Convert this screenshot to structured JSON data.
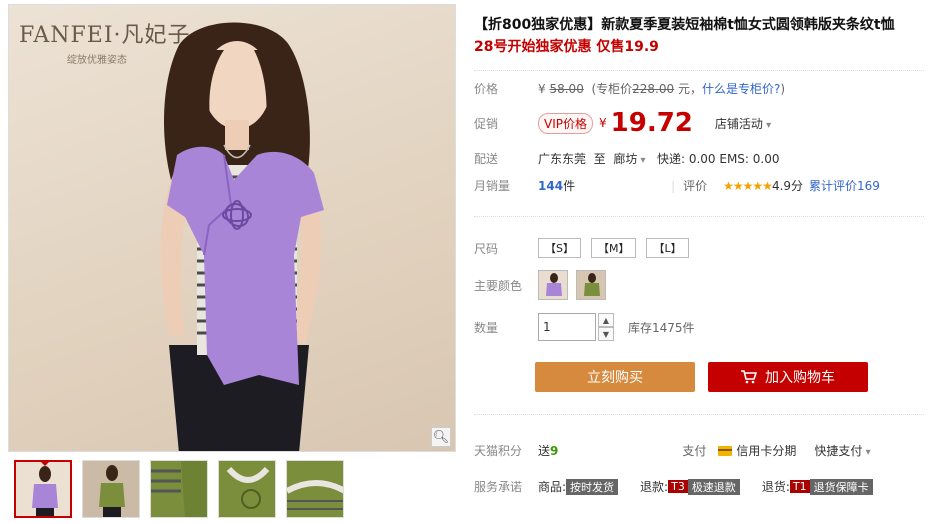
{
  "gallery": {
    "brand_name": "FANFEI·凡妃子",
    "brand_tagline": "绽放优雅姿态",
    "zoom_icon": "magnifier-icon",
    "thumbnails": [
      "purple-top-front",
      "green-top-front",
      "green-detail-1",
      "green-detail-2",
      "green-detail-3"
    ]
  },
  "product": {
    "title": "【折800独家优惠】新款夏季夏装短袖棉t恤女式圆领韩版夹条纹t恤",
    "subtitle": "28号开始独家优惠 仅售19.9"
  },
  "price": {
    "label": "价格",
    "yen": "¥",
    "original": "58.00",
    "counter_prefix": "(专柜价",
    "counter_price": "228.00",
    "counter_suffix": "元，",
    "counter_link": "什么是专柜价?",
    "close": ")"
  },
  "promo": {
    "label": "促销",
    "vip_tag": "VIP价格",
    "yen": "¥",
    "price": "19.72",
    "shop_activity": "店铺活动"
  },
  "shipping": {
    "label": "配送",
    "from": "广东东莞",
    "to_word": "至",
    "to": "廊坊",
    "fees": "快递: 0.00 EMS: 0.00"
  },
  "sales": {
    "label": "月销量",
    "count": "144",
    "unit": "件",
    "rating_label": "评价",
    "stars": "★★★★★",
    "score": "4.9分",
    "total_reviews": "累计评价169"
  },
  "options": {
    "size_label": "尺码",
    "sizes": [
      "【S】",
      "【M】",
      "【L】"
    ],
    "color_label": "主要颜色",
    "colors": [
      "purple",
      "green"
    ],
    "qty_label": "数量",
    "qty_value": "1",
    "stock": "库存1475件"
  },
  "actions": {
    "buy": "立刻购买",
    "cart": "加入购物车"
  },
  "points": {
    "label": "天猫积分",
    "send": "送",
    "value": "9",
    "pay_label": "支付",
    "credit": "信用卡分期",
    "quick_pay": "快捷支付"
  },
  "service": {
    "label": "服务承诺",
    "goods": "商品:",
    "goods_tag": "按时发货",
    "refund": "退款:",
    "refund_code": "T3",
    "refund_tag": "极速退款",
    "return": "退货:",
    "return_code": "T1",
    "return_tag": "退货保障卡"
  },
  "colors": {
    "accent_red": "#c40000",
    "buy_orange": "#d68a3e",
    "link_blue": "#3366cc",
    "star_gold": "#f4a200",
    "shirt_purple": "#a985d8",
    "shirt_green": "#7a8e3c"
  }
}
